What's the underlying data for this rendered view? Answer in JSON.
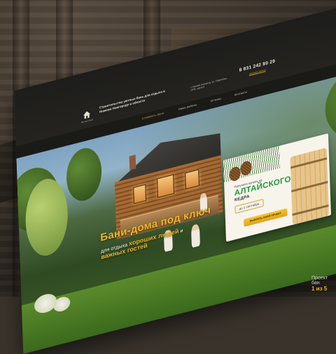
{
  "header": {
    "logo_caption": "Лесная баня",
    "tagline": "Строительство уютных бань для отдыха в Нижнем Новгороде и области",
    "address": "г. Нижний Новгород, ул. Родионова 197В, оф.413",
    "phone": "8 831 242 80 29",
    "callback": "заказать звонок"
  },
  "nav": {
    "items": [
      "Стоимость бани",
      "Наши работы",
      "Отзывы",
      "Контакты"
    ]
  },
  "hero": {
    "headline": "Бани-дома под ключ",
    "sub_prefix": "для отдыха",
    "sub_highlight1": "хороших людей",
    "sub_middle": "и",
    "sub_highlight2": "важных гостей"
  },
  "promo": {
    "kicker": "Получите купель из",
    "title": "АЛТАЙСКОГО",
    "title2": "КЕДРА",
    "deadline": "до 1 сентября",
    "button": "ВЫБРАТЬ СВОЙ ПРОЕКТ"
  },
  "badge": {
    "label": "Проект бан",
    "counter": "1 из 5"
  },
  "colors": {
    "accent": "#f2b623",
    "promo_green": "#1f9a3a"
  }
}
